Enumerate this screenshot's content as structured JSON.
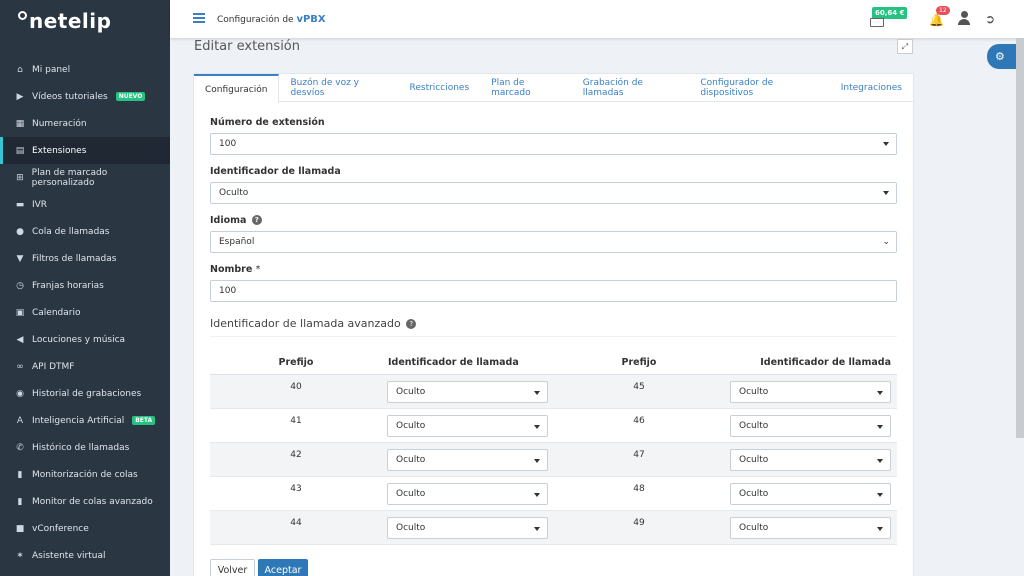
{
  "app": {
    "logo": "netelip"
  },
  "sidebar": {
    "items": [
      {
        "label": "Mi panel",
        "icon": "home-icon",
        "glyph": "⌂"
      },
      {
        "label": "Vídeos tutoriales",
        "icon": "video-icon",
        "glyph": "▶",
        "badge": "NUEVO"
      },
      {
        "label": "Numeración",
        "icon": "grid-icon",
        "glyph": "▦"
      },
      {
        "label": "Extensiones",
        "icon": "list-icon",
        "glyph": "▤",
        "active": true
      },
      {
        "label": "Plan de marcado personalizado",
        "icon": "sitemap-icon",
        "glyph": "⊞"
      },
      {
        "label": "IVR",
        "icon": "comment-icon",
        "glyph": "▬"
      },
      {
        "label": "Cola de llamadas",
        "icon": "user-icon",
        "glyph": "●"
      },
      {
        "label": "Filtros de llamadas",
        "icon": "filter-icon",
        "glyph": "▼"
      },
      {
        "label": "Franjas horarias",
        "icon": "clock-icon",
        "glyph": "◷"
      },
      {
        "label": "Calendario",
        "icon": "calendar-icon",
        "glyph": "▣"
      },
      {
        "label": "Locuciones y música",
        "icon": "volume-icon",
        "glyph": "◀"
      },
      {
        "label": "API DTMF",
        "icon": "link-icon",
        "glyph": "∞"
      },
      {
        "label": "Historial de grabaciones",
        "icon": "record-icon",
        "glyph": "◉"
      },
      {
        "label": "Inteligencia Artificial",
        "icon": "ai-icon",
        "glyph": "A",
        "badge": "BETA"
      },
      {
        "label": "Histórico de llamadas",
        "icon": "phone-icon",
        "glyph": "✆"
      },
      {
        "label": "Monitorización de colas",
        "icon": "bar-chart-icon",
        "glyph": "▮"
      },
      {
        "label": "Monitor de colas avanzado",
        "icon": "bar-chart-icon",
        "glyph": "▮"
      },
      {
        "label": "vConference",
        "icon": "videocam-icon",
        "glyph": "■"
      },
      {
        "label": "Asistente virtual",
        "icon": "star-icon",
        "glyph": "✶"
      }
    ]
  },
  "header": {
    "title_prefix": "Configuración de",
    "title_product": "vPBX",
    "balance": "60,64 €",
    "notifications": "12"
  },
  "page": {
    "title": "Editar extensión",
    "tabs": [
      "Configuración",
      "Buzón de voz y desvíos",
      "Restricciones",
      "Plan de marcado",
      "Grabación de llamadas",
      "Configurador de dispositivos",
      "Integraciones"
    ],
    "active_tab": 0,
    "form": {
      "extension_label": "Número de extensión",
      "extension_value": "100",
      "callerid_label": "Identificador de llamada",
      "callerid_value": "Oculto",
      "language_label": "Idioma",
      "language_value": "Español",
      "name_label": "Nombre",
      "name_required": "*",
      "name_value": "100"
    },
    "advanced": {
      "title": "Identificador de llamada avanzado",
      "columns": [
        "Prefijo",
        "Identificador de llamada",
        "Prefijo",
        "Identificador de llamada"
      ],
      "rows": [
        {
          "left_prefix": "40",
          "left_value": "Oculto",
          "right_prefix": "45",
          "right_value": "Oculto"
        },
        {
          "left_prefix": "41",
          "left_value": "Oculto",
          "right_prefix": "46",
          "right_value": "Oculto"
        },
        {
          "left_prefix": "42",
          "left_value": "Oculto",
          "right_prefix": "47",
          "right_value": "Oculto"
        },
        {
          "left_prefix": "43",
          "left_value": "Oculto",
          "right_prefix": "48",
          "right_value": "Oculto"
        },
        {
          "left_prefix": "44",
          "left_value": "Oculto",
          "right_prefix": "49",
          "right_value": "Oculto"
        }
      ]
    },
    "buttons": {
      "back": "Volver",
      "ok": "Aceptar"
    }
  },
  "colors": {
    "accent": "#2f78b7",
    "sidebar": "#2b3643",
    "success": "#26c281",
    "danger": "#e7505a"
  }
}
